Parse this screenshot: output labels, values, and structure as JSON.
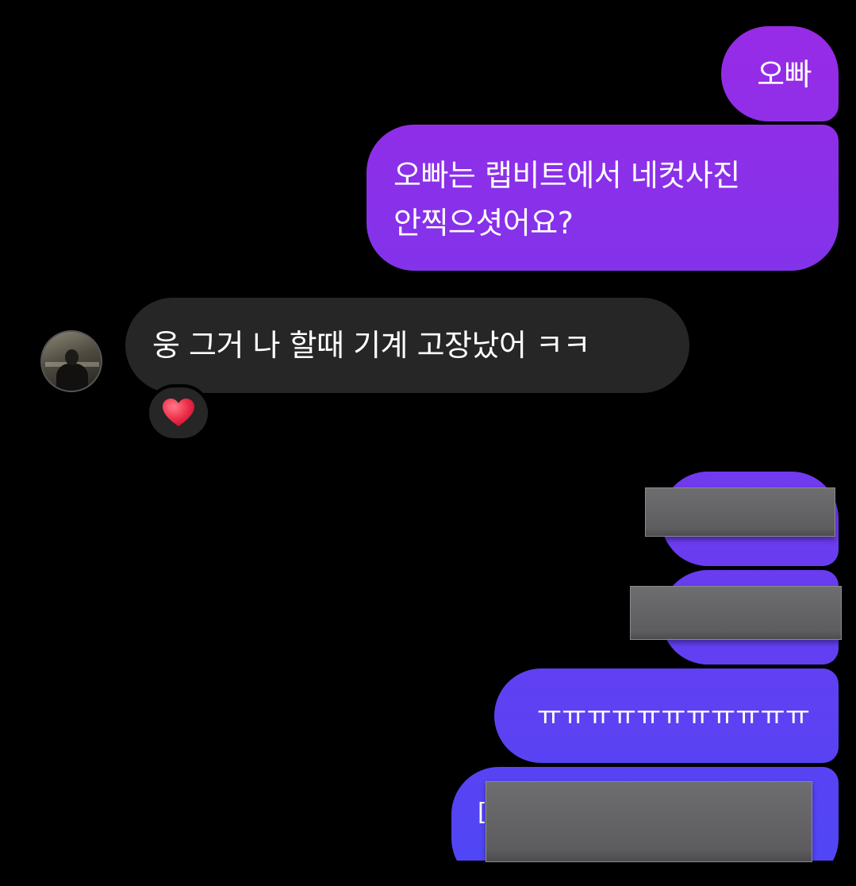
{
  "messages": [
    {
      "id": "b1",
      "direction": "out",
      "text": "오빠"
    },
    {
      "id": "b2",
      "direction": "out",
      "lines": [
        "오빠는 랩비트에서 네컷사진",
        "안찍으셧어요?"
      ]
    },
    {
      "id": "b3",
      "direction": "in",
      "text": "웅 그거 나 할때 기계 고장났어 ㅋㅋ",
      "reaction": "heart-icon"
    },
    {
      "id": "b4",
      "direction": "out",
      "redacted": true
    },
    {
      "id": "b5",
      "direction": "out",
      "redacted": true
    },
    {
      "id": "b6",
      "direction": "out",
      "text": "ㅠㅠㅠㅠㅠㅠㅠㅠㅠㅠㅠ"
    },
    {
      "id": "b7",
      "direction": "out",
      "redacted": true,
      "visible_fragment": "["
    }
  ],
  "colors": {
    "background": "#000000",
    "incoming_bubble": "#262626",
    "outgoing_gradient_top": "#9a2ae6",
    "outgoing_gradient_bottom": "#5046f5",
    "reaction_heart": "#f0344e",
    "redaction_box": "#666668"
  },
  "icons": {
    "avatar": "avatar",
    "reaction": "heart-icon"
  }
}
